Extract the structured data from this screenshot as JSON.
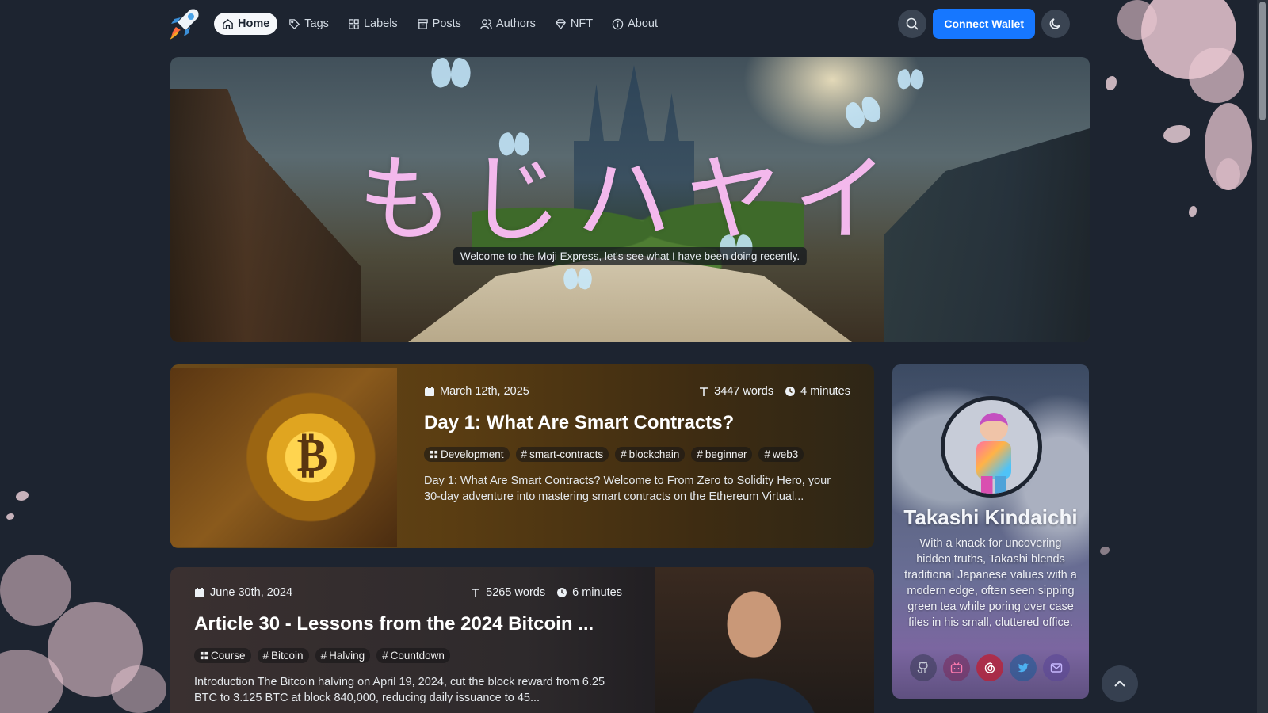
{
  "nav": {
    "items": [
      {
        "label": "Home",
        "icon": "home-icon",
        "active": true
      },
      {
        "label": "Tags",
        "icon": "tag-icon",
        "active": false
      },
      {
        "label": "Labels",
        "icon": "grid-icon",
        "active": false
      },
      {
        "label": "Posts",
        "icon": "archive-icon",
        "active": false
      },
      {
        "label": "Authors",
        "icon": "users-icon",
        "active": false
      },
      {
        "label": "NFT",
        "icon": "diamond-icon",
        "active": false
      },
      {
        "label": "About",
        "icon": "info-icon",
        "active": false
      }
    ],
    "connect_label": "Connect Wallet",
    "accent_color": "#1677ff"
  },
  "hero": {
    "title": "もじハヤイ",
    "subtitle": "Welcome to the Moji Express, let's see what I have been doing recently."
  },
  "posts": [
    {
      "date": "March 12th, 2025",
      "words": "3447 words",
      "time": "4 minutes",
      "title": "Day 1: What Are Smart Contracts?",
      "category": "Development",
      "tags": [
        "smart-contracts",
        "blockchain",
        "beginner",
        "web3"
      ],
      "excerpt": "Day 1: What Are Smart Contracts? Welcome to From Zero to Solidity Hero, your 30-day adventure into mastering smart contracts on the Ethereum Virtual..."
    },
    {
      "date": "June 30th, 2024",
      "words": "5265 words",
      "time": "6 minutes",
      "title": "Article 30 - Lessons from the 2024 Bitcoin ...",
      "category": "Course",
      "tags": [
        "Bitcoin",
        "Halving",
        "Countdown"
      ],
      "excerpt": "Introduction The Bitcoin halving on April 19, 2024, cut the block reward from 6.25 BTC to 3.125 BTC at block 840,000, reducing daily issuance to 45..."
    }
  ],
  "author": {
    "name": "Takashi Kindaichi",
    "bio": "With a knack for uncovering hidden truths, Takashi blends traditional Japanese values with a modern edge, often seen sipping green tea while poring over case files in his small, cluttered office.",
    "socials": [
      "github-icon",
      "bilibili-icon",
      "netease-music-icon",
      "twitter-icon",
      "mail-icon"
    ]
  }
}
